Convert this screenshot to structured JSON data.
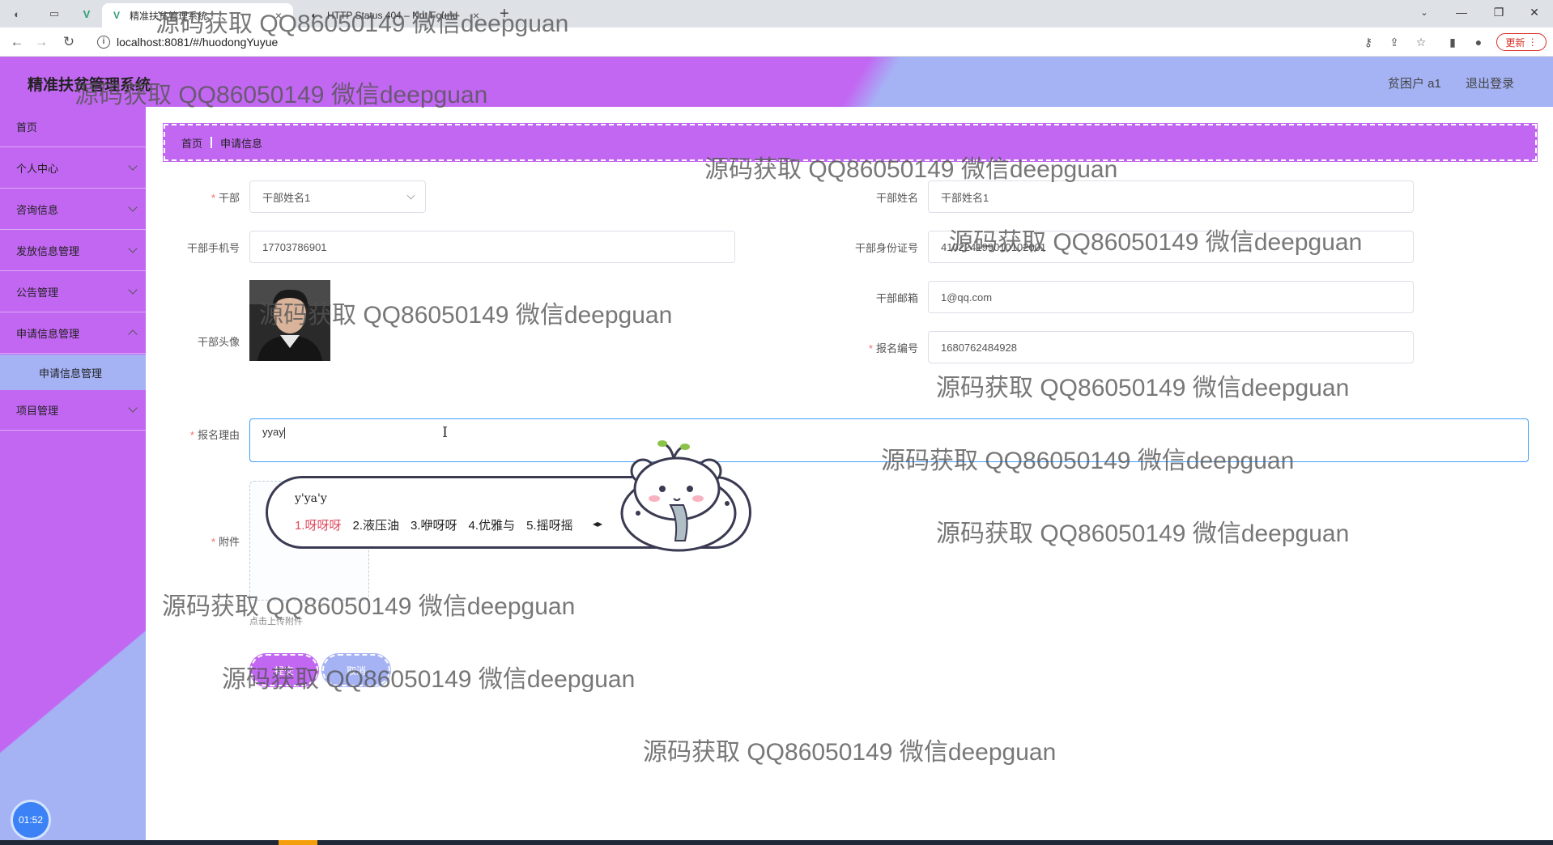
{
  "browser": {
    "tabs": [
      {
        "title": "精准扶贫管理系统",
        "active": true
      },
      {
        "title": "HTTP Status 404 – Not Found",
        "active": false
      }
    ],
    "new_tab": "+",
    "url": "localhost:8081/#/huodongYuyue",
    "update_label": "更新"
  },
  "app": {
    "title": "精准扶贫管理系统",
    "user": "贫困户 a1",
    "logout": "退出登录"
  },
  "sidebar": {
    "items": [
      {
        "label": "首页"
      },
      {
        "label": "个人中心"
      },
      {
        "label": "咨询信息"
      },
      {
        "label": "发放信息管理"
      },
      {
        "label": "公告管理"
      },
      {
        "label": "申请信息管理"
      },
      {
        "label": "项目管理"
      }
    ],
    "sub_item": "申请信息管理",
    "clock": "01:52"
  },
  "breadcrumb": {
    "home": "首页",
    "current": "申请信息"
  },
  "form": {
    "cadre_label": "干部",
    "cadre_value": "干部姓名1",
    "cadre_name_label": "干部姓名",
    "cadre_name_value": "干部姓名1",
    "phone_label": "干部手机号",
    "phone_value": "17703786901",
    "id_label": "干部身份证号",
    "id_value": "410224199010102001",
    "email_label": "干部邮箱",
    "email_value": "1@qq.com",
    "avatar_label": "干部头像",
    "reg_no_label": "报名编号",
    "reg_no_value": "1680762484928",
    "reason_label": "报名理由",
    "reason_value": "yyay",
    "attach_label": "附件",
    "upload_tip": "点击上传附件",
    "submit": "提交",
    "cancel": "取消"
  },
  "ime": {
    "pinyin": "y'ya'y",
    "candidates": [
      "1.呀呀呀",
      "2.液压油",
      "3.咿呀呀",
      "4.优雅与",
      "5.摇呀摇"
    ]
  },
  "watermark": "源码获取 QQ86050149 微信deepguan",
  "colors": {
    "primary": "#c267f2",
    "secondary": "#a5b3f5",
    "required": "#f56c6c",
    "focus": "#409eff"
  }
}
